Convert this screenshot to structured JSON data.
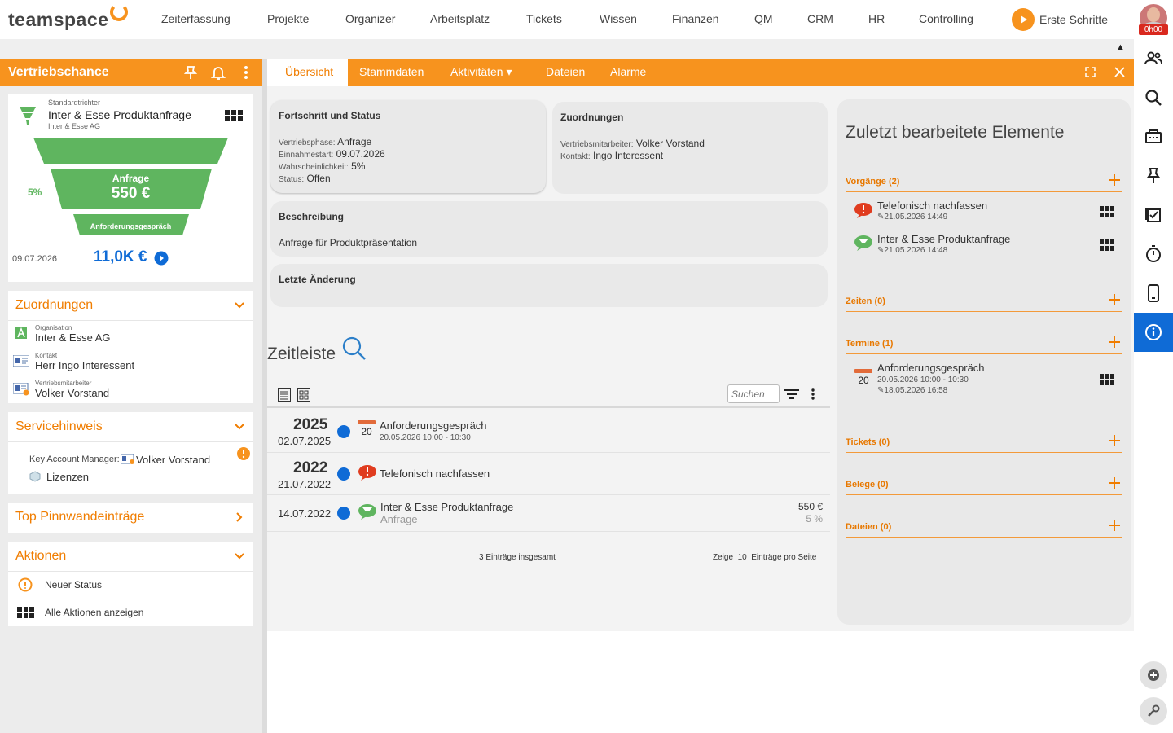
{
  "app": {
    "name": "teamspace"
  },
  "nav": {
    "items": [
      "Zeiterfassung",
      "Projekte",
      "Organizer",
      "Arbeitsplatz",
      "Tickets",
      "Wissen",
      "Finanzen",
      "QM",
      "CRM",
      "HR",
      "Controlling"
    ],
    "erste_schritte": "Erste Schritte",
    "timer": "0h00"
  },
  "left": {
    "title": "Vertriebschance",
    "funnel_card": {
      "trichter": "Standardtrichter",
      "name": "Inter & Esse Produktanfrage",
      "org": "Inter & Esse AG",
      "stage": "Anfrage",
      "amount": "550 €",
      "next_stage": "Anforderungsgespräch",
      "percent": "5%",
      "date": "09.07.2026",
      "total": "11,0K €"
    },
    "zuordnungen": {
      "title": "Zuordnungen",
      "org_label": "Organisation",
      "org": "Inter & Esse AG",
      "kontakt_label": "Kontakt",
      "kontakt": "Herr Ingo Interessent",
      "mitarbeiter_label": "Vertriebsmitarbeiter",
      "mitarbeiter": "Volker Vorstand"
    },
    "servicehinweis": {
      "title": "Servicehinweis",
      "kam_label": "Key Account Manager:",
      "kam": "Volker Vorstand",
      "lizenzen": "Lizenzen"
    },
    "pinnwand": {
      "title": "Top Pinnwandeinträge"
    },
    "aktionen": {
      "title": "Aktionen",
      "neuer_status": "Neuer Status",
      "alle": "Alle Aktionen anzeigen"
    }
  },
  "tabs": [
    {
      "label": "Übersicht",
      "active": true
    },
    {
      "label": "Stammdaten"
    },
    {
      "label": "Aktivitäten ▾"
    },
    {
      "label": "Dateien"
    },
    {
      "label": "Alarme"
    }
  ],
  "fortschritt": {
    "title": "Fortschritt und Status",
    "phase_label": "Vertriebsphase:",
    "phase": "Anfrage",
    "start_label": "Einnahmestart:",
    "start": "09.07.2026",
    "wk_label": "Wahrscheinlichkeit:",
    "wk": "5%",
    "status_label": "Status:",
    "status": "Offen"
  },
  "zuordnungen_box": {
    "title": "Zuordnungen",
    "ma_label": "Vertriebsmitarbeiter:",
    "ma": "Volker Vorstand",
    "kontakt_label": "Kontakt:",
    "kontakt": "Ingo Interessent"
  },
  "beschreibung": {
    "title": "Beschreibung",
    "text": "Anfrage für Produktpräsentation"
  },
  "letzte": {
    "title": "Letzte Änderung"
  },
  "zeitleiste": {
    "title": "Zeitleiste",
    "search_placeholder": "Suchen",
    "rows": [
      {
        "year": "2025",
        "date": "02.07.2025",
        "title": "Anforderungsgespräch",
        "sub": "20.05.2026 10:00 - 10:30",
        "cal_day": "20"
      },
      {
        "year": "2022",
        "date": "21.07.2022",
        "title": "Telefonisch nachfassen"
      },
      {
        "date": "14.07.2022",
        "title": "Inter & Esse Produktanfrage",
        "sub": "Anfrage",
        "amount": "550 €",
        "percent": "5 %"
      }
    ],
    "total": "3 Einträge insgesamt",
    "zeige": "Zeige",
    "per_page": "10",
    "pro_seite": "Einträge pro Seite"
  },
  "recent": {
    "title": "Zuletzt bearbeitete Elemente",
    "vorgaenge": {
      "label": "Vorgänge (2)",
      "items": [
        {
          "title": "Telefonisch nachfassen",
          "time": "21.05.2026 14:49"
        },
        {
          "title": "Inter & Esse Produktanfrage",
          "time": "21.05.2026 14:48"
        }
      ]
    },
    "zeiten": {
      "label": "Zeiten (0)"
    },
    "termine": {
      "label": "Termine (1)",
      "items": [
        {
          "title": "Anforderungsgespräch",
          "range": "20.05.2026 10:00 - 10:30",
          "time": "18.05.2026 16:58",
          "cal_day": "20"
        }
      ]
    },
    "tickets": {
      "label": "Tickets (0)"
    },
    "belege": {
      "label": "Belege (0)"
    },
    "dateien": {
      "label": "Dateien (0)"
    }
  },
  "colors": {
    "accent": "#f7931e",
    "blue": "#0f6bd6",
    "green": "#5fb55f",
    "red": "#e03c1f"
  }
}
